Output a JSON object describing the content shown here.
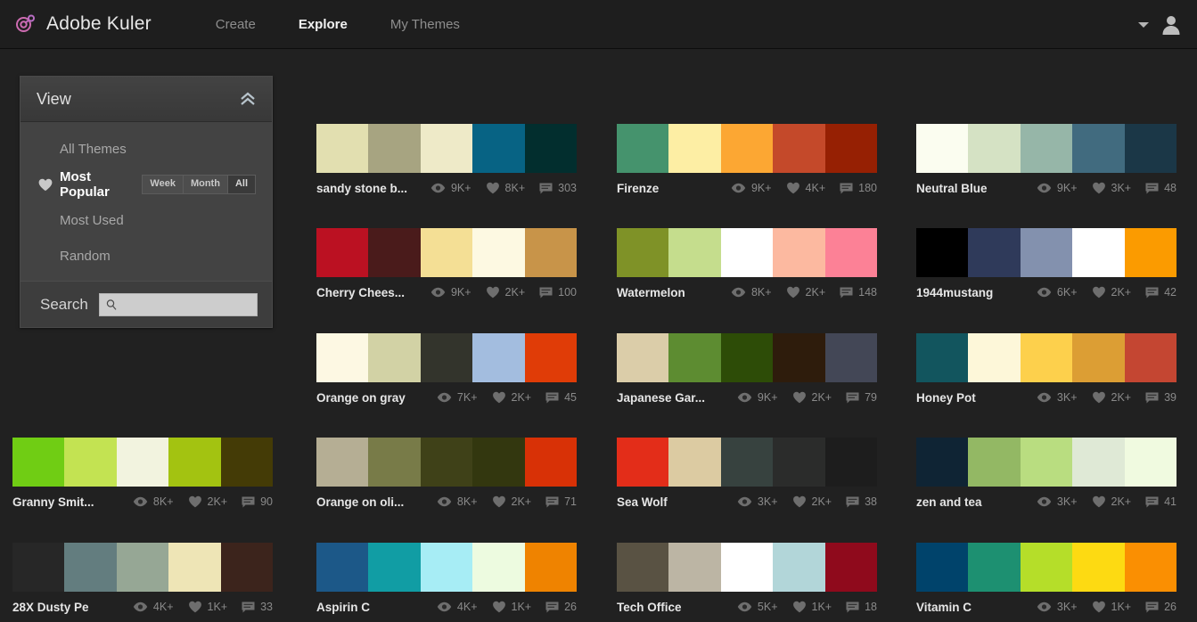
{
  "header": {
    "brand": "Adobe Kuler",
    "nav": [
      {
        "label": "Create",
        "active": false
      },
      {
        "label": "Explore",
        "active": true
      },
      {
        "label": "My Themes",
        "active": false
      }
    ]
  },
  "sidebar": {
    "panel_title": "View",
    "collapse_icon": "chevron-up-icon",
    "items": [
      {
        "label": "All Themes",
        "active": false,
        "heart": false
      },
      {
        "label": "Most Popular",
        "active": true,
        "heart": true
      },
      {
        "label": "Most Used",
        "active": false,
        "heart": false
      },
      {
        "label": "Random",
        "active": false,
        "heart": false
      }
    ],
    "range_options": [
      {
        "label": "Week",
        "active": false
      },
      {
        "label": "Month",
        "active": false
      },
      {
        "label": "All",
        "active": true
      }
    ],
    "search_label": "Search",
    "search_value": "",
    "search_placeholder": "",
    "search_icon": "search-icon"
  },
  "icons": {
    "views": "eye-icon",
    "likes": "heart-icon",
    "comments": "comment-icon",
    "account": "user-avatar-icon",
    "account_caret": "chevron-down-icon"
  },
  "themes": [
    {
      "title": "sandy stone b...",
      "views": "9K+",
      "likes": "8K+",
      "comments": "303",
      "colors": [
        "#e2dfb0",
        "#a7a481",
        "#eeeac8",
        "#076384",
        "#022e2e"
      ],
      "col": 1,
      "row": 1
    },
    {
      "title": "Firenze",
      "views": "9K+",
      "likes": "4K+",
      "comments": "180",
      "colors": [
        "#45936d",
        "#fdeea4",
        "#fca733",
        "#c4492a",
        "#962003"
      ],
      "col": 2,
      "row": 1
    },
    {
      "title": "Neutral Blue",
      "views": "9K+",
      "likes": "3K+",
      "comments": "48",
      "colors": [
        "#fbfdf0",
        "#d5e2c4",
        "#96b6a8",
        "#416b7f",
        "#1b3747"
      ],
      "col": 3,
      "row": 1
    },
    {
      "title": "Cherry Chees...",
      "views": "9K+",
      "likes": "2K+",
      "comments": "100",
      "colors": [
        "#bb1122",
        "#4a1b1b",
        "#f4df95",
        "#fdf9e2",
        "#c89449"
      ],
      "col": 1,
      "row": 2
    },
    {
      "title": "Watermelon",
      "views": "8K+",
      "likes": "2K+",
      "comments": "148",
      "colors": [
        "#7f9227",
        "#c5dd8d",
        "#ffffff",
        "#fcb9a0",
        "#fc8196"
      ],
      "col": 2,
      "row": 2
    },
    {
      "title": "1944mustang",
      "views": "6K+",
      "likes": "2K+",
      "comments": "42",
      "colors": [
        "#000000",
        "#2f3a5a",
        "#8391ae",
        "#ffffff",
        "#fb9b00"
      ],
      "col": 3,
      "row": 2
    },
    {
      "title": "Orange on gray",
      "views": "7K+",
      "likes": "2K+",
      "comments": "45",
      "colors": [
        "#fdf8e3",
        "#d2d2a5",
        "#33342c",
        "#a3bddf",
        "#e03c07"
      ],
      "col": 1,
      "row": 3
    },
    {
      "title": "Japanese Gar...",
      "views": "9K+",
      "likes": "2K+",
      "comments": "79",
      "colors": [
        "#dbcda9",
        "#5d8c31",
        "#2d4c07",
        "#2e1c0c",
        "#434756"
      ],
      "col": 2,
      "row": 3
    },
    {
      "title": "Honey Pot",
      "views": "3K+",
      "likes": "2K+",
      "comments": "39",
      "colors": [
        "#12555e",
        "#fdf7d9",
        "#fdd04c",
        "#dc9e34",
        "#c44632"
      ],
      "col": 3,
      "row": 3
    },
    {
      "title": "Granny Smit...",
      "views": "8K+",
      "likes": "2K+",
      "comments": "90",
      "colors": [
        "#70cd14",
        "#c3e352",
        "#f2f3df",
        "#a3c311",
        "#443b06"
      ],
      "col": 0,
      "row": 4
    },
    {
      "title": "Orange on oli...",
      "views": "8K+",
      "likes": "2K+",
      "comments": "71",
      "colors": [
        "#b5ae94",
        "#787b48",
        "#3f4118",
        "#33370f",
        "#d83106"
      ],
      "col": 1,
      "row": 4
    },
    {
      "title": "Sea Wolf",
      "views": "3K+",
      "likes": "2K+",
      "comments": "38",
      "colors": [
        "#e32d19",
        "#dccba2",
        "#37423f",
        "#2b2c2b",
        "#1d1d1d"
      ],
      "col": 2,
      "row": 4
    },
    {
      "title": "zen and tea",
      "views": "3K+",
      "likes": "2K+",
      "comments": "41",
      "colors": [
        "#0f2434",
        "#93b864",
        "#b9dd80",
        "#dfe9d6",
        "#f0fae0"
      ],
      "col": 3,
      "row": 4
    },
    {
      "title": "28X Dusty Pe",
      "views": "4K+",
      "likes": "1K+",
      "comments": "33",
      "colors": [
        "#272727",
        "#637d7f",
        "#96a795",
        "#eee5b6",
        "#3c241c"
      ],
      "col": 0,
      "row": 5
    },
    {
      "title": "Aspirin C",
      "views": "4K+",
      "likes": "1K+",
      "comments": "26",
      "colors": [
        "#1c5888",
        "#119da4",
        "#a7edf5",
        "#edfbe0",
        "#ef8300"
      ],
      "col": 1,
      "row": 5
    },
    {
      "title": "Tech Office",
      "views": "5K+",
      "likes": "1K+",
      "comments": "18",
      "colors": [
        "#595243",
        "#bcb5a4",
        "#ffffff",
        "#b2d6d9",
        "#8f0a1c"
      ],
      "col": 2,
      "row": 5
    },
    {
      "title": "Vitamin C",
      "views": "3K+",
      "likes": "1K+",
      "comments": "26",
      "colors": [
        "#00436b",
        "#1d9071",
        "#b5de29",
        "#fdda12",
        "#fa8f02"
      ],
      "col": 3,
      "row": 5
    }
  ]
}
